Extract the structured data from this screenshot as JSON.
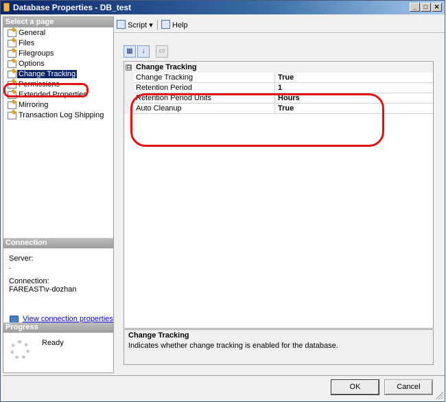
{
  "window": {
    "title": "Database Properties - DB_test"
  },
  "left_pane": {
    "select_page_header": "Select a page",
    "pages": [
      {
        "label": "General"
      },
      {
        "label": "Files"
      },
      {
        "label": "Filegroups"
      },
      {
        "label": "Options"
      },
      {
        "label": "Change Tracking",
        "selected": true
      },
      {
        "label": "Permissions"
      },
      {
        "label": "Extended Properties"
      },
      {
        "label": "Mirroring"
      },
      {
        "label": "Transaction Log Shipping"
      }
    ],
    "connection_header": "Connection",
    "server_label": "Server:",
    "server_value": ".",
    "connection_label": "Connection:",
    "connection_value": "FAREAST\\v-dozhan",
    "view_connection_link": "View connection properties",
    "progress_header": "Progress",
    "progress_status": "Ready"
  },
  "toolbar": {
    "script_label": "Script",
    "script_dropdown_glyph": "▾",
    "help_label": "Help"
  },
  "grid": {
    "category_toggle_glyph": "⊟",
    "category_label": "Change Tracking",
    "properties": [
      {
        "name": "Change Tracking",
        "value": "True"
      },
      {
        "name": "Retention Period",
        "value": "1"
      },
      {
        "name": "Retention Period Units",
        "value": "Hours"
      },
      {
        "name": "Auto Cleanup",
        "value": "True"
      }
    ]
  },
  "description": {
    "title": "Change Tracking",
    "text": "Indicates whether change tracking is enabled for the database."
  },
  "buttons": {
    "ok": "OK",
    "cancel": "Cancel"
  },
  "colors": {
    "selection": "#0a246a",
    "annotation_red": "#e01010",
    "link": "#0000ee"
  }
}
